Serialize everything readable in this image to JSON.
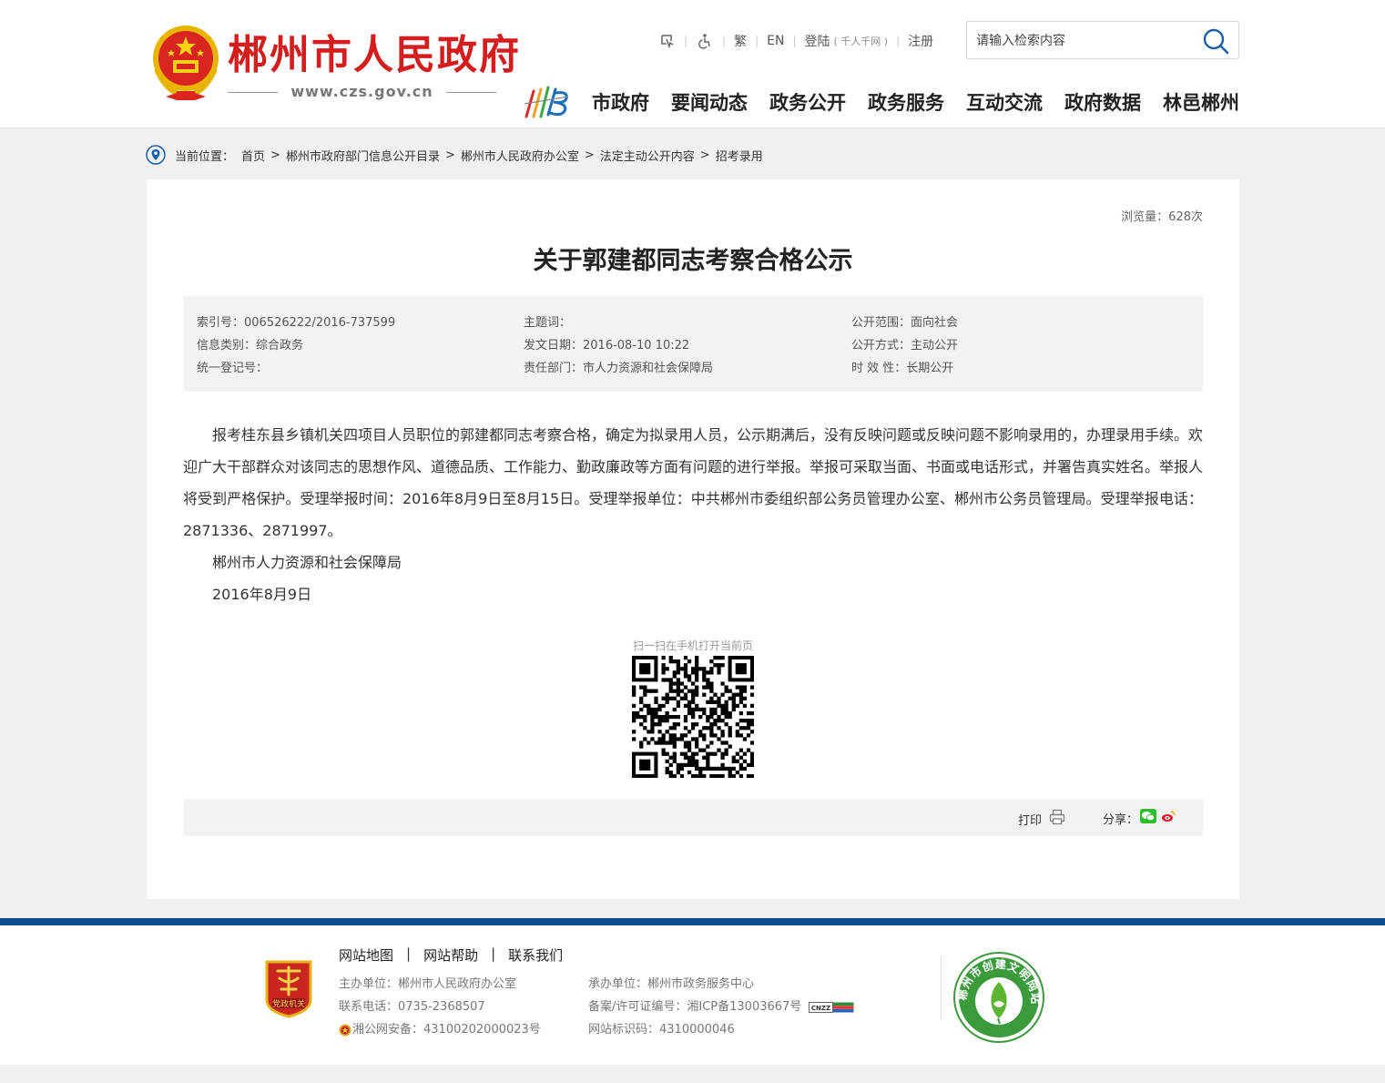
{
  "header": {
    "site_title": "郴州市人民政府",
    "site_url": "www.czs.gov.cn",
    "links": {
      "traditional": "繁",
      "english": "EN",
      "login": "登陆",
      "login_note": "( 千人千网 )",
      "register": "注册"
    },
    "search": {
      "placeholder": "请输入检索内容"
    },
    "nav": [
      "市政府",
      "要闻动态",
      "政务公开",
      "政务服务",
      "互动交流",
      "政府数据",
      "林邑郴州"
    ],
    "nav_logo_text": "MB"
  },
  "breadcrumb": {
    "label": "当前位置：",
    "items": [
      "首页",
      "郴州市政府部门信息公开目录",
      "郴州市人民政府办公室",
      "法定主动公开内容",
      "招考录用"
    ]
  },
  "article": {
    "views": "浏览量：628次",
    "title": "关于郭建都同志考察合格公示",
    "meta": {
      "index_no": "索引号：006526222/2016-737599",
      "category": "信息类别：综合政务",
      "reg_no": "统一登记号：",
      "keywords": "主题词：",
      "date": "发文日期：2016-08-10 10:22",
      "dept": "责任部门：市人力资源和社会保障局",
      "scope": "公开范围：面向社会",
      "method": "公开方式：主动公开",
      "validity": "时 效 性：长期公开"
    },
    "body": "报考桂东县乡镇机关四项目人员职位的郭建都同志考察合格，确定为拟录用人员，公示期满后，没有反映问题或反映问题不影响录用的，办理录用手续。欢迎广大干部群众对该同志的思想作风、道德品质、工作能力、勤政廉政等方面有问题的进行举报。举报可采取当面、书面或电话形式，并署告真实姓名。举报人将受到严格保护。受理举报时间：2016年8月9日至8月15日。受理举报单位：中共郴州市委组织部公务员管理办公室、郴州市公务员管理局。受理举报电话：2871336、2871997。",
    "signature": "郴州市人力资源和社会保障局",
    "sign_date": "2016年8月9日",
    "qr_label": "扫一扫在手机打开当前页",
    "print_label": "打印",
    "share_label": "分享："
  },
  "footer": {
    "links": [
      "网站地图",
      "网站帮助",
      "联系我们"
    ],
    "sponsor": "主办单位：郴州市人民政府办公室",
    "phone": "联系电话：0735-2368507",
    "police": "湘公网安备：43100202000023号",
    "organizer": "承办单位：郴州市政务服务中心",
    "icp": "备案/许可证编号：湘ICP备13003667号",
    "site_id": "网站标识码：4310000046",
    "party_badge_text": "党政机关",
    "civ_badge_text": "郴州市创建文明网站"
  },
  "colors": {
    "brand_red": "#d41d1d",
    "footer_blue": "#0e4c92",
    "nav_blue": "#1a6fb5"
  }
}
